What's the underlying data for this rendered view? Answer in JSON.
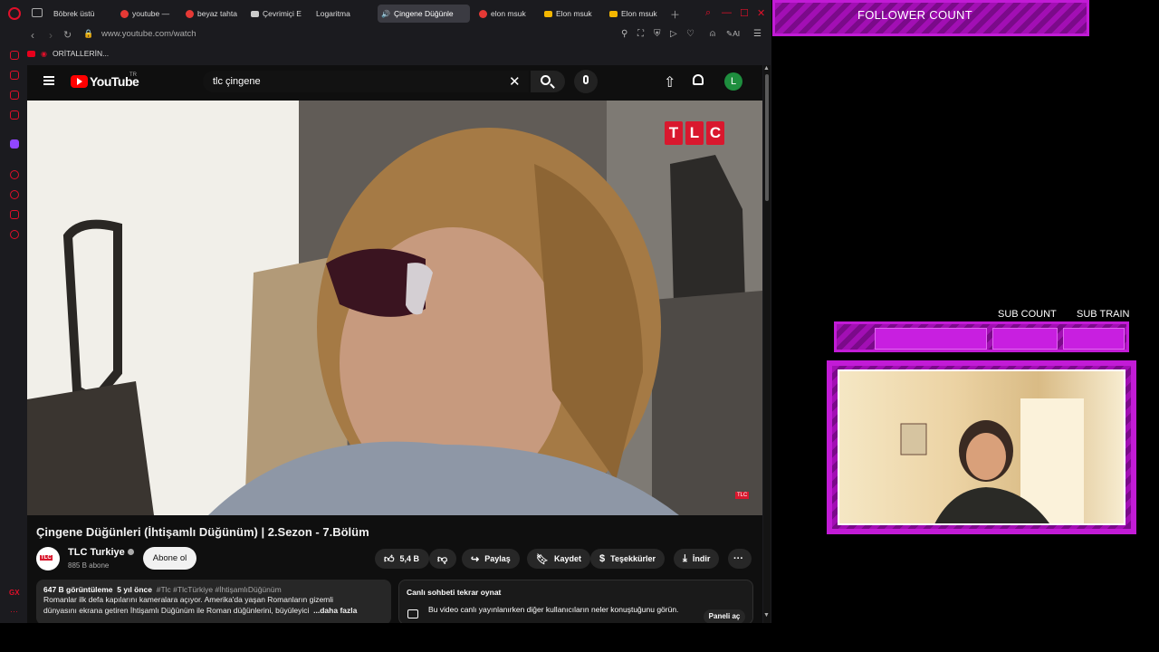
{
  "browser": {
    "tabs": [
      {
        "title": "Böbrek üstü",
        "icon": "youtube-icon",
        "active": false
      },
      {
        "title": "youtube —",
        "icon": "yandex-icon",
        "active": false
      },
      {
        "title": "beyaz tahta",
        "icon": "yandex-icon",
        "active": false
      },
      {
        "title": "Çevrimiçi E",
        "icon": "document-icon",
        "active": false
      },
      {
        "title": "Logaritma",
        "icon": "youtube-icon",
        "active": false
      },
      {
        "title": "Çingene Düğünle",
        "icon": "youtube-icon",
        "active": true
      },
      {
        "title": "elon msuk",
        "icon": "yandex-icon",
        "active": false
      },
      {
        "title": "Elon msuk",
        "icon": "folder-icon",
        "active": false
      },
      {
        "title": "Elon msuk",
        "icon": "folder-icon",
        "active": false
      }
    ],
    "url": "www.youtube.com/watch",
    "ai_label": "AI",
    "bookmark": "ORİTALLERİN..."
  },
  "youtube": {
    "logo_text": "YouTube",
    "region": "TR",
    "search_value": "tlc çingene",
    "avatar_letter": "L",
    "video": {
      "title": "Çingene Düğünleri (İhtişamlı Düğünüm) | 2.Sezon - 7.Bölüm",
      "tlc_letters": [
        "T",
        "L",
        "C"
      ],
      "tlc_small": "TLC"
    },
    "channel": {
      "name": "TLC Turkiye",
      "subscribers": "885 B abone",
      "subscribe_label": "Abone ol"
    },
    "actions": {
      "likes": "5,4 B",
      "share": "Paylaş",
      "save": "Kaydet",
      "thanks": "Teşekkürler",
      "download": "İndir"
    },
    "description": {
      "views": "647 B görüntüleme",
      "age": "5 yıl önce",
      "tags": "#Tlc #TlcTürkiye #İhtişamlıDüğünüm",
      "line1": "Romanlar ilk defa kapılarını kameralara açıyor. Amerika'da yaşan Romanların gizemli",
      "line2": "dünyasını ekrana getiren İhtişamlı Düğünüm ile Roman düğünlerini, büyüleyici",
      "more": "...daha fazla"
    },
    "chat": {
      "title": "Canlı sohbeti tekrar oynat",
      "text": "Bu video canlı yayınlanırken diğer kullanıcıların neler konuştuğunu görün.",
      "button": "Paneli aç"
    }
  },
  "overlay": {
    "follower_label": "FOLLOWER COUNT",
    "sub_count_label": "SUB COUNT",
    "sub_train_label": "SUB TRAIN",
    "accent": "#c21bd6"
  }
}
